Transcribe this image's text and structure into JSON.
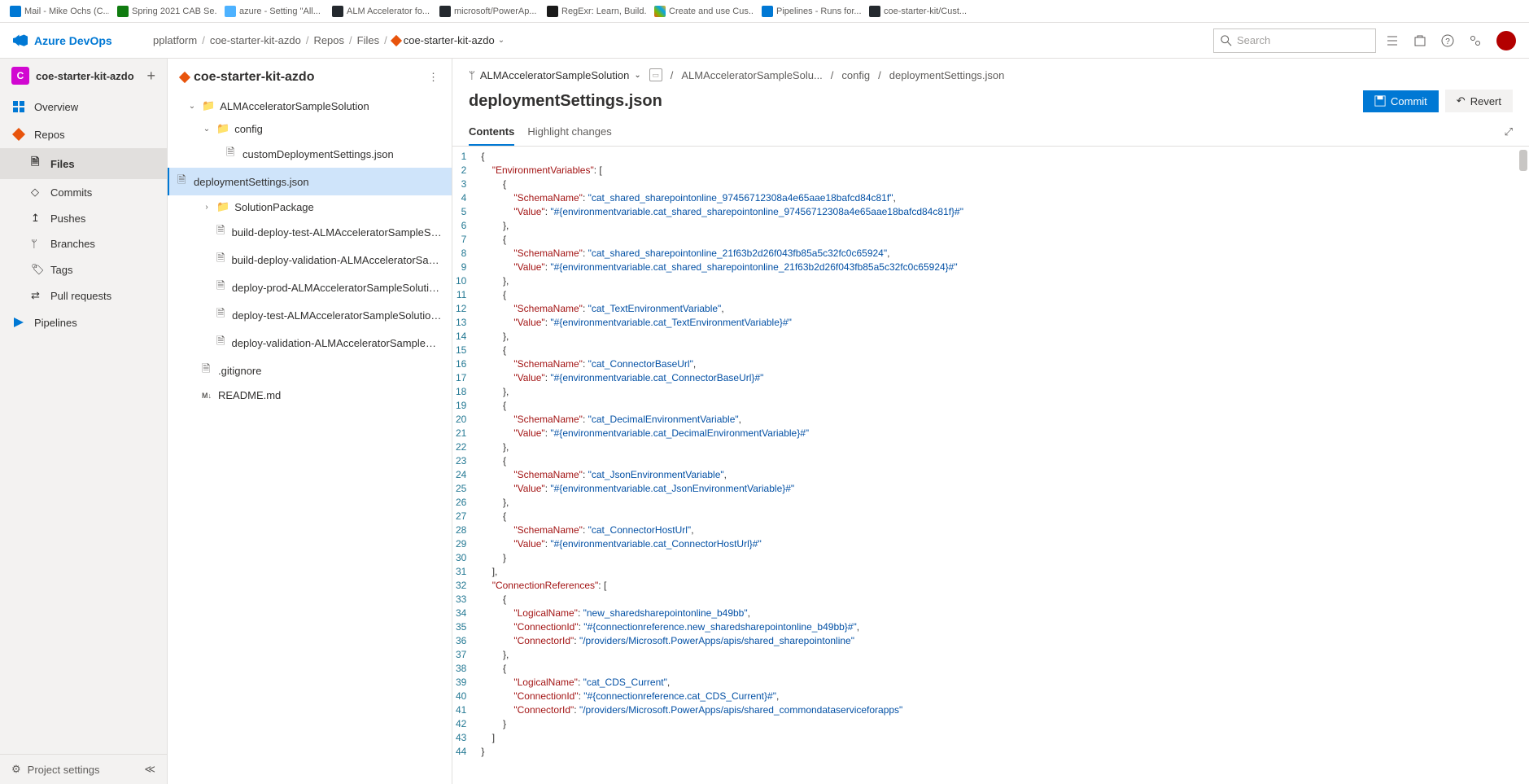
{
  "browser_tabs": [
    {
      "label": "Mail - Mike Ochs (C...",
      "color": "#0078d4"
    },
    {
      "label": "Spring 2021 CAB Se...",
      "color": "#107c10"
    },
    {
      "label": "azure - Setting \"All...",
      "color": "#0078d4"
    },
    {
      "label": "ALM Accelerator fo...",
      "color": "#24292e"
    },
    {
      "label": "microsoft/PowerAp...",
      "color": "#24292e"
    },
    {
      "label": "RegExr: Learn, Build...",
      "color": "#1a1a1a"
    },
    {
      "label": "Create and use Cus...",
      "color": "#0078d4"
    },
    {
      "label": "Pipelines - Runs for...",
      "color": "#0078d4"
    },
    {
      "label": "coe-starter-kit/Cust...",
      "color": "#24292e"
    }
  ],
  "brand": "Azure DevOps",
  "breadcrumbs": [
    "pplatform",
    "coe-starter-kit-azdo",
    "Repos",
    "Files"
  ],
  "breadcrumb_last": "coe-starter-kit-azdo",
  "search_placeholder": "Search",
  "project": {
    "letter": "C",
    "name": "coe-starter-kit-azdo"
  },
  "nav": {
    "overview": "Overview",
    "repos": "Repos",
    "sub": {
      "files": "Files",
      "commits": "Commits",
      "pushes": "Pushes",
      "branches": "Branches",
      "tags": "Tags",
      "pull_requests": "Pull requests"
    },
    "pipelines": "Pipelines",
    "project_settings": "Project settings"
  },
  "repo_name": "coe-starter-kit-azdo",
  "tree": {
    "folder1": "ALMAcceleratorSampleSolution",
    "folder2": "config",
    "file_custom": "customDeploymentSettings.json",
    "file_deploy": "deploymentSettings.json",
    "folder3": "SolutionPackage",
    "yml1": "build-deploy-test-ALMAcceleratorSampleSolutio...",
    "yml2": "build-deploy-validation-ALMAcceleratorSampleS...",
    "yml3": "deploy-prod-ALMAcceleratorSampleSolution.yml",
    "yml4": "deploy-test-ALMAcceleratorSampleSolution.yml",
    "yml5": "deploy-validation-ALMAcceleratorSampleSolutio...",
    "gitignore": ".gitignore",
    "readme": "README.md"
  },
  "path_bar": {
    "branch": "ALMAcceleratorSampleSolution",
    "segs": [
      "ALMAcceleratorSampleSolu...",
      "config",
      "deploymentSettings.json"
    ]
  },
  "file_title": "deploymentSettings.json",
  "actions": {
    "commit": "Commit",
    "revert": "Revert"
  },
  "tabs": {
    "contents": "Contents",
    "highlight": "Highlight changes"
  },
  "code": {
    "l1": "{",
    "l2_k": "\"EnvironmentVariables\"",
    "l2_r": ": [",
    "l3": "        {",
    "l4_k": "\"SchemaName\"",
    "l4_v": "\"cat_shared_sharepointonline_97456712308a4e65aae18bafcd84c81f\"",
    "l4_r": ",",
    "l5_k": "\"Value\"",
    "l5_v": "\"#{environmentvariable.cat_shared_sharepointonline_97456712308a4e65aae18bafcd84c81f}#\"",
    "l6": "        },",
    "l7": "        {",
    "l8_k": "\"SchemaName\"",
    "l8_v": "\"cat_shared_sharepointonline_21f63b2d26f043fb85a5c32fc0c65924\"",
    "l8_r": ",",
    "l9_k": "\"Value\"",
    "l9_v": "\"#{environmentvariable.cat_shared_sharepointonline_21f63b2d26f043fb85a5c32fc0c65924}#\"",
    "l10": "        },",
    "l11": "        {",
    "l12_k": "\"SchemaName\"",
    "l12_v": "\"cat_TextEnvironmentVariable\"",
    "l12_r": ",",
    "l13_k": "\"Value\"",
    "l13_v": "\"#{environmentvariable.cat_TextEnvironmentVariable}#\"",
    "l14": "        },",
    "l15": "        {",
    "l16_k": "\"SchemaName\"",
    "l16_v": "\"cat_ConnectorBaseUrl\"",
    "l16_r": ",",
    "l17_k": "\"Value\"",
    "l17_v": "\"#{environmentvariable.cat_ConnectorBaseUrl}#\"",
    "l18": "        },",
    "l19": "        {",
    "l20_k": "\"SchemaName\"",
    "l20_v": "\"cat_DecimalEnvironmentVariable\"",
    "l20_r": ",",
    "l21_k": "\"Value\"",
    "l21_v": "\"#{environmentvariable.cat_DecimalEnvironmentVariable}#\"",
    "l22": "        },",
    "l23": "        {",
    "l24_k": "\"SchemaName\"",
    "l24_v": "\"cat_JsonEnvironmentVariable\"",
    "l24_r": ",",
    "l25_k": "\"Value\"",
    "l25_v": "\"#{environmentvariable.cat_JsonEnvironmentVariable}#\"",
    "l26": "        },",
    "l27": "        {",
    "l28_k": "\"SchemaName\"",
    "l28_v": "\"cat_ConnectorHostUrl\"",
    "l28_r": ",",
    "l29_k": "\"Value\"",
    "l29_v": "\"#{environmentvariable.cat_ConnectorHostUrl}#\"",
    "l30": "        }",
    "l31": "    ],",
    "l32_k": "\"ConnectionReferences\"",
    "l32_r": ": [",
    "l33": "        {",
    "l34_k": "\"LogicalName\"",
    "l34_v": "\"new_sharedsharepointonline_b49bb\"",
    "l34_r": ",",
    "l35_k": "\"ConnectionId\"",
    "l35_v": "\"#{connectionreference.new_sharedsharepointonline_b49bb}#\"",
    "l35_r": ",",
    "l36_k": "\"ConnectorId\"",
    "l36_v": "\"/providers/Microsoft.PowerApps/apis/shared_sharepointonline\"",
    "l37": "        },",
    "l38": "        {",
    "l39_k": "\"LogicalName\"",
    "l39_v": "\"cat_CDS_Current\"",
    "l39_r": ",",
    "l40_k": "\"ConnectionId\"",
    "l40_v": "\"#{connectionreference.cat_CDS_Current}#\"",
    "l40_r": ",",
    "l41_k": "\"ConnectorId\"",
    "l41_v": "\"/providers/Microsoft.PowerApps/apis/shared_commondataserviceforapps\"",
    "l42": "        }",
    "l43": "    ]",
    "l44": "}"
  }
}
